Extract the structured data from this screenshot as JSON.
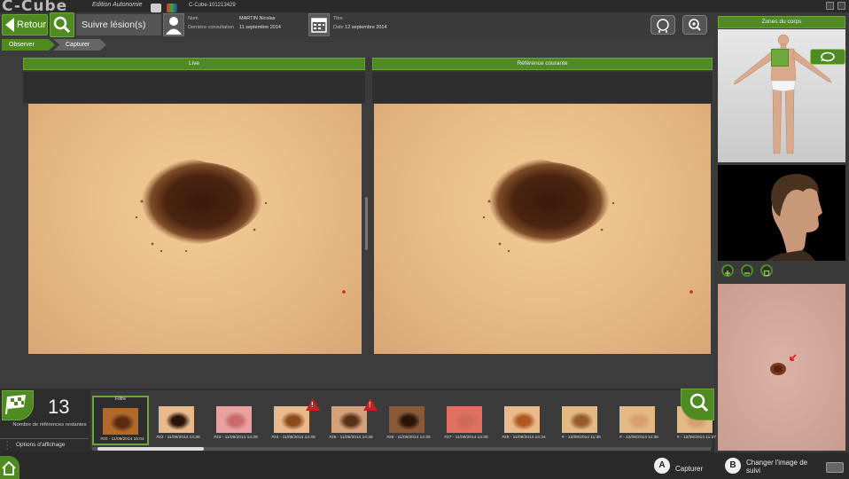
{
  "app": {
    "logo": "C-Cube",
    "edition": "Edition Autonomie",
    "serial": "C-Cube-101213429"
  },
  "header": {
    "back_label": "Retour",
    "mode_title": "Suivre lésion(s)",
    "patient": {
      "name_label": "Nom",
      "name_value": "MARTIN Nicolas",
      "last_label": "Dernière consultation",
      "last_value": "11 septembre 2014"
    },
    "session": {
      "title_label": "Titre",
      "title_value": "",
      "date_label": "Date",
      "date_value": "12 septembre 2014"
    }
  },
  "tabs": [
    {
      "label": "Observer"
    },
    {
      "label": "Capturer"
    }
  ],
  "panels": {
    "live_label": "Live",
    "reference_label": "Référence courante"
  },
  "sidebar": {
    "title": "Zones du corps"
  },
  "bottom": {
    "remaining_count": "13",
    "remaining_label": "Nombre de références restantes",
    "options_label": "Options d'affichage",
    "filter_label": "Filtre",
    "thumbnails": [
      {
        "caption": "#20 - 11/09/2014 15:04",
        "selected": true,
        "warning": false,
        "tone": "#b06a2a",
        "spot": "#5a2a10"
      },
      {
        "caption": "#22 - 11/09/2014 14:38",
        "selected": false,
        "warning": false,
        "tone": "#e8b98a",
        "spot": "#2a1408"
      },
      {
        "caption": "#23 - 11/09/2014 14:39",
        "selected": false,
        "warning": false,
        "tone": "#e9a0a0",
        "spot": "#c96b6b"
      },
      {
        "caption": "#24 - 11/09/2014 14:48",
        "selected": false,
        "warning": true,
        "tone": "#e8b98a",
        "spot": "#8a4a1a"
      },
      {
        "caption": "#25 - 11/09/2014 14:38",
        "selected": false,
        "warning": true,
        "tone": "#d4a07a",
        "spot": "#5a3018"
      },
      {
        "caption": "#26 - 11/09/2014 14:36",
        "selected": false,
        "warning": false,
        "tone": "#8a5a38",
        "spot": "#2a1408"
      },
      {
        "caption": "#27 - 11/09/2014 14:35",
        "selected": false,
        "warning": false,
        "tone": "#e07060",
        "spot": "#d06a58"
      },
      {
        "caption": "#28 - 11/09/2014 14:34",
        "selected": false,
        "warning": false,
        "tone": "#e8b98a",
        "spot": "#b0581e"
      },
      {
        "caption": "# - 12/09/2014 11:36",
        "selected": false,
        "warning": false,
        "tone": "#e3b986",
        "spot": "#9a5a30"
      },
      {
        "caption": "# - 12/09/2014 11:36",
        "selected": false,
        "warning": false,
        "tone": "#e3b986",
        "spot": "#d8a070"
      },
      {
        "caption": "# - 12/09/2014 11:37",
        "selected": false,
        "warning": false,
        "tone": "#e3b986",
        "spot": "#d8a070"
      }
    ]
  },
  "footer": {
    "key_a": "A",
    "key_a_label": "Capturer",
    "key_b": "B",
    "key_b_label": "Changer l'image de suivi"
  },
  "colors": {
    "accent_green": "#4f8a23",
    "warning_red": "#c62020",
    "background": "#3c3c3c"
  }
}
